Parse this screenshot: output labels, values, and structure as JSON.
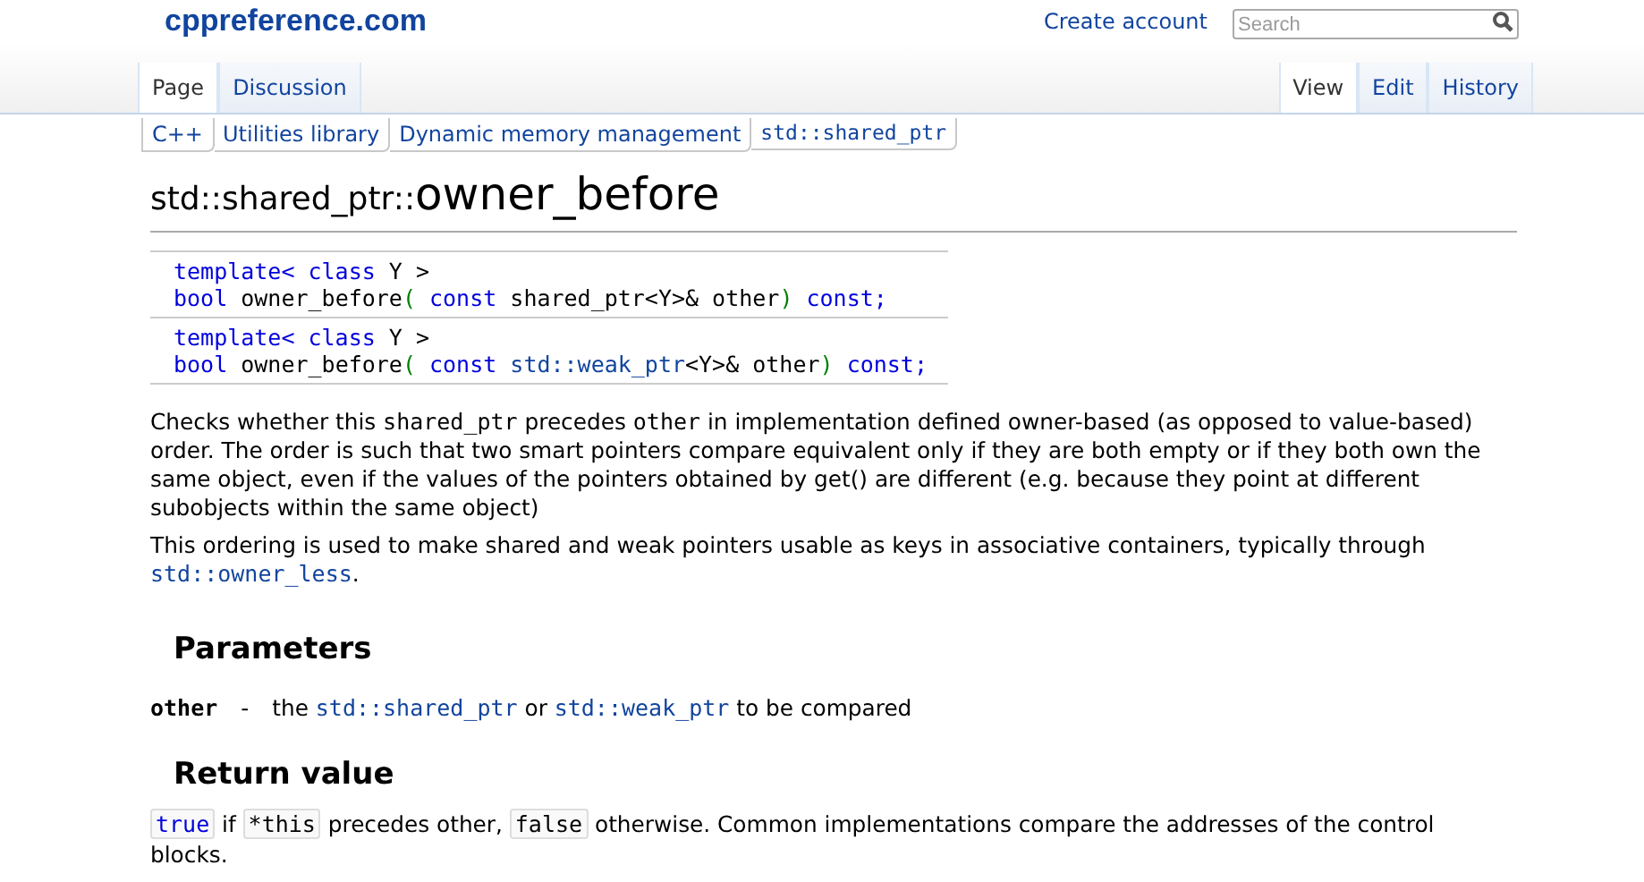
{
  "header": {
    "site": "cppreference.com",
    "create_account": "Create account",
    "search": {
      "placeholder": "Search"
    }
  },
  "left_tabs": [
    {
      "label": "Page",
      "selected": true
    },
    {
      "label": "Discussion",
      "selected": false
    }
  ],
  "right_tabs": [
    {
      "label": "View",
      "selected": true
    },
    {
      "label": "Edit",
      "selected": false
    },
    {
      "label": "History",
      "selected": false
    }
  ],
  "breadcrumbs": [
    {
      "label": "C++",
      "kind": "text"
    },
    {
      "label": "Utilities library",
      "kind": "text"
    },
    {
      "label": "Dynamic memory management",
      "kind": "text"
    },
    {
      "label": "std::shared_ptr",
      "kind": "code"
    }
  ],
  "title": {
    "prefix": "std::shared_ptr::",
    "name": "owner_before"
  },
  "declarations": [
    {
      "lines": [
        [
          {
            "text": "template<",
            "kind": "keyword"
          },
          {
            "text": " class",
            "kind": "keyword"
          },
          {
            "text": " Y >",
            "kind": "plain"
          }
        ],
        [
          {
            "text": "bool",
            "kind": "keyword"
          },
          {
            "text": " owner_before",
            "kind": "plain"
          },
          {
            "text": "(",
            "kind": "paren"
          },
          {
            "text": " const",
            "kind": "keyword"
          },
          {
            "text": " shared_ptr<Y>& other",
            "kind": "plain"
          },
          {
            "text": ")",
            "kind": "paren"
          },
          {
            "text": " const;",
            "kind": "keyword"
          }
        ]
      ]
    },
    {
      "lines": [
        [
          {
            "text": "template<",
            "kind": "keyword"
          },
          {
            "text": " class",
            "kind": "keyword"
          },
          {
            "text": " Y >",
            "kind": "plain"
          }
        ],
        [
          {
            "text": "bool",
            "kind": "keyword"
          },
          {
            "text": " owner_before",
            "kind": "plain"
          },
          {
            "text": "(",
            "kind": "paren"
          },
          {
            "text": " const",
            "kind": "keyword"
          },
          {
            "text": " std::weak_ptr",
            "kind": "link"
          },
          {
            "text": "<Y>& other",
            "kind": "plain"
          },
          {
            "text": ")",
            "kind": "paren"
          },
          {
            "text": " const;",
            "kind": "keyword"
          }
        ]
      ]
    }
  ],
  "description": [
    [
      {
        "text": "Checks whether this ",
        "kind": "text"
      },
      {
        "text": "shared_ptr",
        "kind": "code"
      },
      {
        "text": " precedes ",
        "kind": "text"
      },
      {
        "text": "other",
        "kind": "code"
      },
      {
        "text": " in implementation defined owner-based (as opposed to value-based) order. The order is such that two smart pointers compare equivalent only if they are both empty or if they both own the same object, even if the values of the pointers obtained by get() are different (e.g. because they point at different subobjects within the same object)",
        "kind": "text"
      }
    ],
    [
      {
        "text": "This ordering is used to make shared and weak pointers usable as keys in associative containers, typically through ",
        "kind": "text"
      },
      {
        "text": "std::owner_less",
        "kind": "link"
      },
      {
        "text": ".",
        "kind": "text"
      }
    ]
  ],
  "parameters": {
    "heading": "Parameters",
    "items": [
      {
        "name": "other",
        "dash": "-",
        "description": [
          {
            "text": "the ",
            "kind": "text"
          },
          {
            "text": "std::shared_ptr",
            "kind": "link"
          },
          {
            "text": " or ",
            "kind": "text"
          },
          {
            "text": "std::weak_ptr",
            "kind": "link"
          },
          {
            "text": " to be compared",
            "kind": "text"
          }
        ]
      }
    ]
  },
  "return_value": {
    "heading": "Return value",
    "text": [
      {
        "text": "true",
        "kind": "boxed"
      },
      {
        "text": " if ",
        "kind": "text"
      },
      {
        "text": "*this",
        "kind": "boxed"
      },
      {
        "text": " precedes other, ",
        "kind": "text"
      },
      {
        "text": "false",
        "kind": "boxed"
      },
      {
        "text": " otherwise. Common implementations compare the addresses of the control blocks.",
        "kind": "text"
      }
    ]
  }
}
